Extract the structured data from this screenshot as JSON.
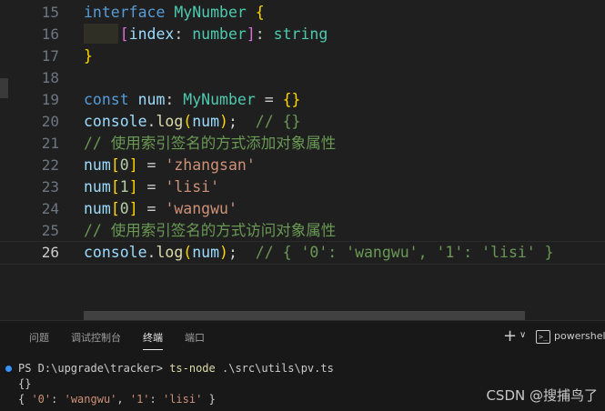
{
  "editor": {
    "lines": [
      {
        "n": "15"
      },
      {
        "n": "16"
      },
      {
        "n": "17"
      },
      {
        "n": "18"
      },
      {
        "n": "19"
      },
      {
        "n": "20"
      },
      {
        "n": "21"
      },
      {
        "n": "22"
      },
      {
        "n": "23"
      },
      {
        "n": "24"
      },
      {
        "n": "25"
      },
      {
        "n": "26"
      }
    ],
    "tokens": {
      "interface": "interface",
      "MyNumber": "MyNumber",
      "brace_open": "{",
      "brace_close": "}",
      "bracket_open": "[",
      "bracket_close": "]",
      "index": "index",
      "number": "number",
      "string": "string",
      "const": "const",
      "num": "num",
      "console": "console",
      "log": "log",
      "empty_obj": "{}",
      "cmt20": "// {}",
      "cmt21": "// 使用索引签名的方式添加对象属性",
      "zero": "0",
      "one": "1",
      "zhangsan": "'zhangsan'",
      "lisi": "'lisi'",
      "wangwu": "'wangwu'",
      "cmt25": "// 使用索引签名的方式访问对象属性",
      "cmt26": "// { '0': 'wangwu', '1': 'lisi' }"
    }
  },
  "panel": {
    "tabs": [
      "问题",
      "调试控制台",
      "终端",
      "端口"
    ],
    "active_tab": "终端",
    "shell": "powershell",
    "terminal": {
      "prompt": "PS D:\\upgrade\\tracker>",
      "command": "ts-node",
      "args": ".\\src\\utils\\pv.ts",
      "output1": "{}",
      "output2_a": "{ ",
      "output2_k0": "'0'",
      "output2_sep1": ": ",
      "output2_v0": "'wangwu'",
      "output2_sep2": ", ",
      "output2_k1": "'1'",
      "output2_sep3": ": ",
      "output2_v1": "'lisi'",
      "output2_end": " }"
    }
  },
  "watermark": "CSDN @搜捕鸟了"
}
